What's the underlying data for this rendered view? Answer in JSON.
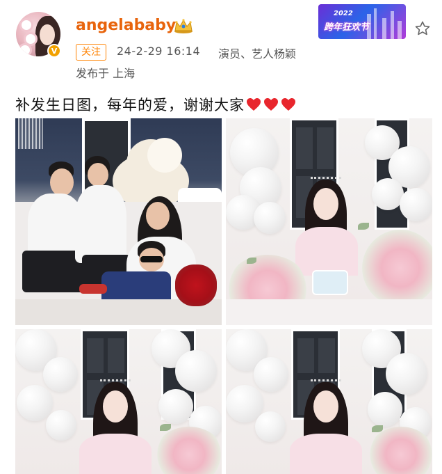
{
  "post": {
    "username": "angelababy",
    "follow_label": "关注",
    "timestamp": "24-2-29 16:14",
    "source": "演员、艺人杨颖",
    "location": "发布于 上海",
    "text": "补发生日图，每年的爱，谢谢大家",
    "heart_count": 3
  },
  "banner": {
    "year": "2022",
    "title": "跨年狂欢节"
  },
  "icons": {
    "crown": "crown-badge-icon",
    "verified": "verified-v-icon",
    "star": "star-outline-icon",
    "heart": "red-heart-icon"
  },
  "colors": {
    "username": "#e8640c",
    "follow": "#ff8200",
    "heart": "#e8262d",
    "verified": "#f2a100"
  },
  "photos": [
    {
      "subject": "family-birthday-photo"
    },
    {
      "subject": "birthday-cake-photo"
    },
    {
      "subject": "balloon-portrait-photo-1"
    },
    {
      "subject": "balloon-portrait-photo-2"
    }
  ]
}
